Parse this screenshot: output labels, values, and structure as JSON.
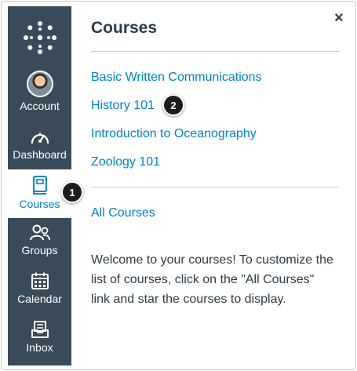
{
  "nav": {
    "items": [
      {
        "label": "Account",
        "icon": "avatar"
      },
      {
        "label": "Dashboard",
        "icon": "dashboard-icon"
      },
      {
        "label": "Courses",
        "icon": "courses-icon",
        "active": true
      },
      {
        "label": "Groups",
        "icon": "groups-icon"
      },
      {
        "label": "Calendar",
        "icon": "calendar-icon"
      },
      {
        "label": "Inbox",
        "icon": "inbox-icon"
      }
    ]
  },
  "tray": {
    "title": "Courses",
    "close_label": "×",
    "courses": [
      {
        "label": "Basic Written Communications"
      },
      {
        "label": "History 101"
      },
      {
        "label": "Introduction to Oceanography"
      },
      {
        "label": "Zoology 101"
      }
    ],
    "all_courses_label": "All Courses",
    "help_text": "Welcome to your courses! To customize the list of courses, click on the \"All Courses\" link and star the courses to display."
  },
  "markers": [
    "1",
    "2"
  ],
  "colors": {
    "sidebar": "#394b58",
    "link": "#0081c6",
    "text": "#2d3b45",
    "marker": "#1d1d1d"
  }
}
